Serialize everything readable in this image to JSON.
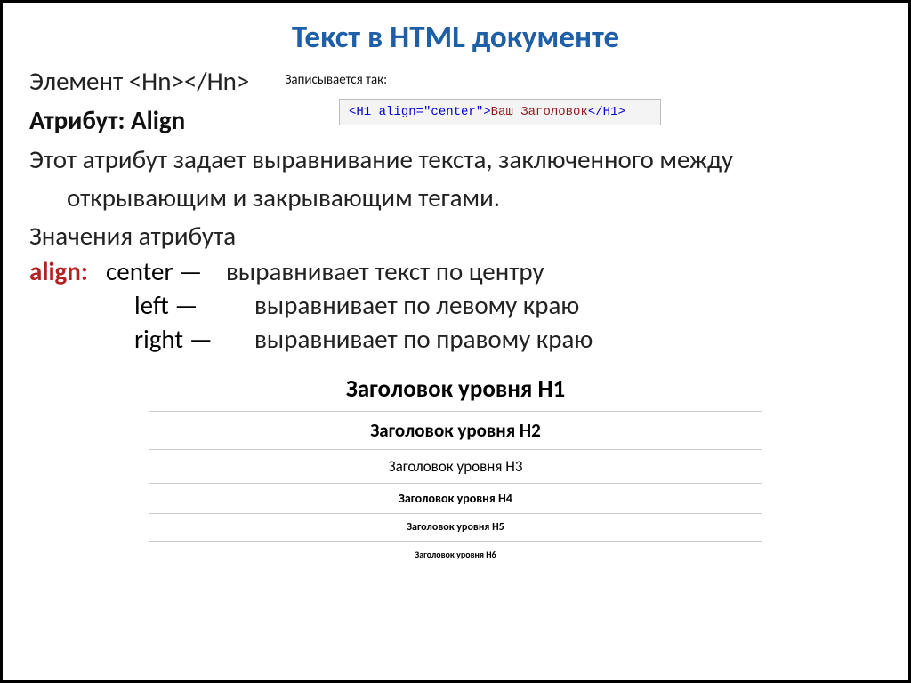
{
  "title": "Текст в HTML документе",
  "element_line": "Элемент <Hn></Hn>",
  "written_as": "Записывается так:",
  "attribute_title": "Атрибут: Align",
  "code": {
    "open_tag": "<H1 ",
    "attr": "align=\"center\"",
    "open_end": ">",
    "content": "Ваш Заголовок",
    "close_tag": "</H1>"
  },
  "desc_line1": "Этот атрибут задает выравнивание текста, заключенного между",
  "desc_line2": "открывающим и закрывающим тегами.",
  "values_label": "Значения атрибута",
  "align_key": "align:",
  "vals": [
    {
      "name": "center —",
      "desc": "выравнивает текст по центру"
    },
    {
      "name": "left —",
      "desc": "выравнивает по левому краю"
    },
    {
      "name": "right —",
      "desc": "выравнивает по правому краю"
    }
  ],
  "headings": {
    "h1": "Заголовок уровня H1",
    "h2": "Заголовок уровня H2",
    "h3": "Заголовок уровня H3",
    "h4": "Заголовок уровня H4",
    "h5": "Заголовок уровня H5",
    "h6": "Заголовок уровня H6"
  }
}
